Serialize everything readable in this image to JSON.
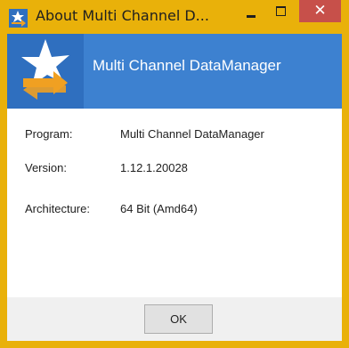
{
  "window": {
    "title": "About Multi Channel D...",
    "minimize_label": "−",
    "maximize_label": "□",
    "close_label": "✕"
  },
  "colors": {
    "titlebar": "#e9b10a",
    "banner": "#3d81d0",
    "close_button": "#c7504a",
    "logo_star": "#ffffff",
    "logo_arrow": "#f0a022"
  },
  "banner": {
    "title": "Multi Channel DataManager"
  },
  "info": [
    {
      "label": "Program:",
      "value": "Multi Channel DataManager"
    },
    {
      "label": "Version:",
      "value": "1.12.1.20028"
    },
    {
      "label": "Architecture:",
      "value": "64 Bit (Amd64)"
    }
  ],
  "footer": {
    "ok_label": "OK"
  },
  "icons": {
    "app": "app-logo-icon",
    "banner_logo": "app-logo-icon"
  }
}
